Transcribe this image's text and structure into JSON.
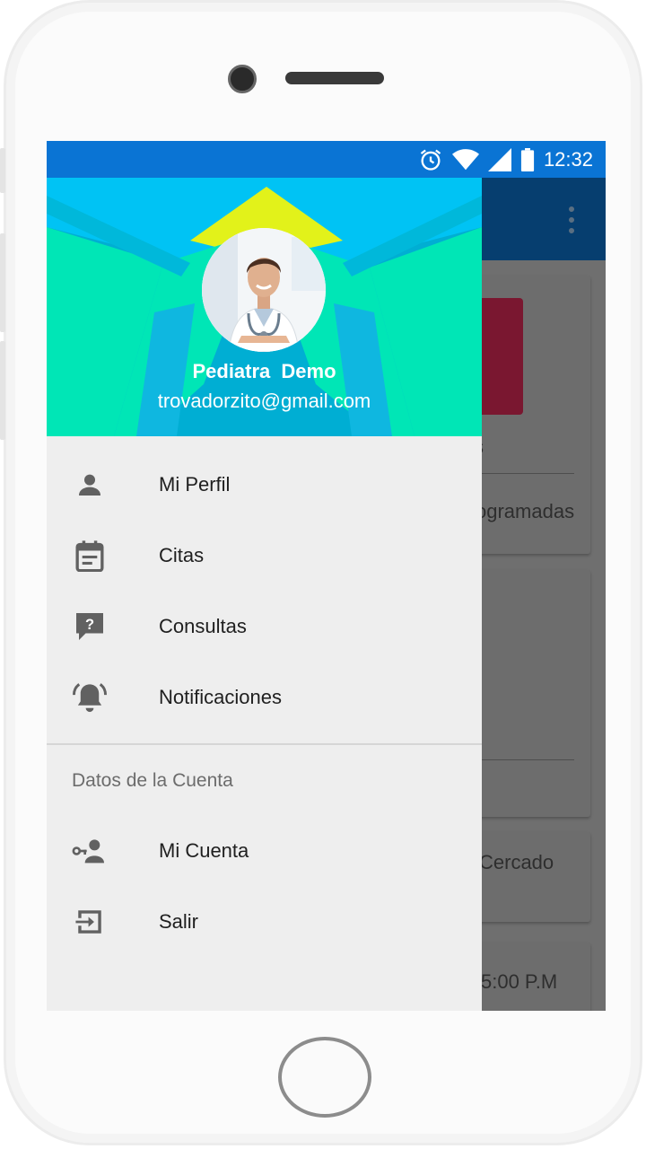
{
  "status_bar": {
    "time": "12:32",
    "icons": [
      "alarm-icon",
      "wifi-icon",
      "signal-icon",
      "battery-icon"
    ],
    "color": "#0a74d4"
  },
  "drawer": {
    "user": {
      "name": "Pediatra  Demo",
      "email": "trovadorzito@gmail.com"
    },
    "menu": [
      {
        "label": "Mi Perfil",
        "icon": "person-icon"
      },
      {
        "label": "Citas",
        "icon": "calendar-icon"
      },
      {
        "label": "Consultas",
        "icon": "question-chat-icon"
      },
      {
        "label": "Notificaciones",
        "icon": "bell-ringing-icon"
      }
    ],
    "account_section": {
      "title": "Datos de la Cuenta",
      "items": [
        {
          "label": "Mi Cuenta",
          "icon": "account-key-icon"
        },
        {
          "label": "Salir",
          "icon": "exit-icon"
        }
      ]
    },
    "header_colors": {
      "cyan": "#00c3f4",
      "mint": "#00e6b6",
      "teal": "#00aed3",
      "yellow": "#e2f21a"
    }
  },
  "background": {
    "text_fragment_1": "s",
    "text_fragment_2": "ogramadas",
    "text_fragment_3": "Cercado",
    "text_fragment_4": "5:00 P.M"
  }
}
